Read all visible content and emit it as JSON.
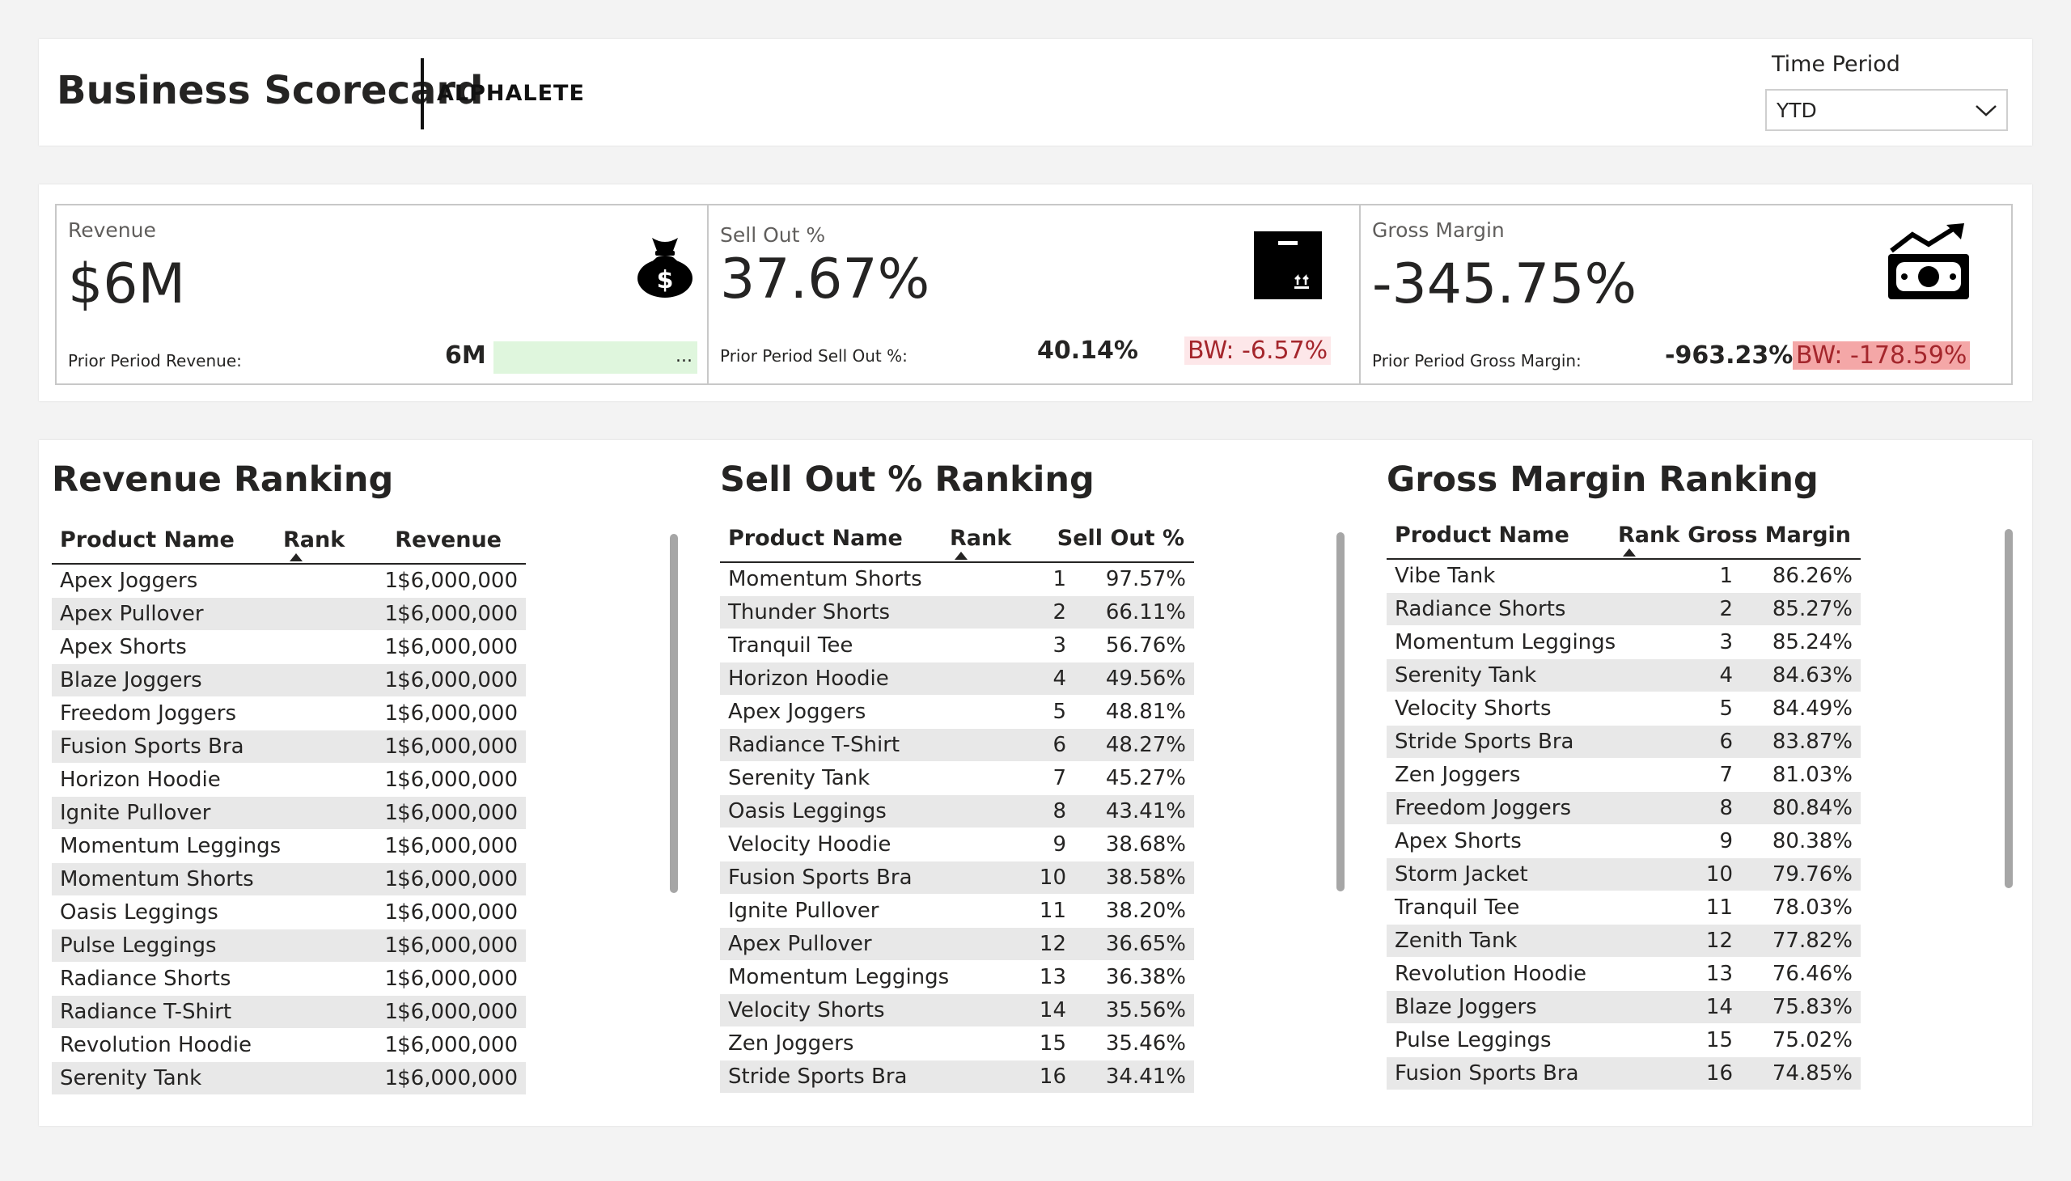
{
  "header": {
    "title": "Business Scorecard",
    "brand": "ALPHALETE",
    "time_period_label": "Time Period",
    "time_period_value": "YTD"
  },
  "kpis": {
    "revenue": {
      "label": "Revenue",
      "value": "$6M",
      "prior_label": "Prior Period Revenue:",
      "prior_value": "6M",
      "more": "...",
      "icon": "money-bag-icon"
    },
    "sellout": {
      "label": "Sell Out %",
      "value": "37.67%",
      "prior_label": "Prior Period Sell Out %:",
      "prior_value": "40.14%",
      "bw": "BW: -6.57%",
      "icon": "box-icon"
    },
    "margin": {
      "label": "Gross Margin",
      "value": "-345.75%",
      "prior_label": "Prior Period Gross Margin:",
      "prior_value": "-963.23%",
      "bw": "BW: -178.59%",
      "icon": "cash-growth-icon"
    }
  },
  "colors": {
    "positive_bg": "#dff6dd",
    "light_negative_bg": "#fde7e9",
    "strong_negative_bg": "#f4a7a7",
    "negative_text": "#a4262c"
  },
  "rankings": {
    "revenue": {
      "title": "Revenue Ranking",
      "columns": [
        "Product Name",
        "Rank",
        "Revenue"
      ],
      "rows": [
        [
          "Apex Joggers",
          "1",
          "$6,000,000"
        ],
        [
          "Apex Pullover",
          "1",
          "$6,000,000"
        ],
        [
          "Apex Shorts",
          "1",
          "$6,000,000"
        ],
        [
          "Blaze Joggers",
          "1",
          "$6,000,000"
        ],
        [
          "Freedom Joggers",
          "1",
          "$6,000,000"
        ],
        [
          "Fusion Sports Bra",
          "1",
          "$6,000,000"
        ],
        [
          "Horizon Hoodie",
          "1",
          "$6,000,000"
        ],
        [
          "Ignite Pullover",
          "1",
          "$6,000,000"
        ],
        [
          "Momentum Leggings",
          "1",
          "$6,000,000"
        ],
        [
          "Momentum Shorts",
          "1",
          "$6,000,000"
        ],
        [
          "Oasis Leggings",
          "1",
          "$6,000,000"
        ],
        [
          "Pulse Leggings",
          "1",
          "$6,000,000"
        ],
        [
          "Radiance Shorts",
          "1",
          "$6,000,000"
        ],
        [
          "Radiance T-Shirt",
          "1",
          "$6,000,000"
        ],
        [
          "Revolution Hoodie",
          "1",
          "$6,000,000"
        ],
        [
          "Serenity Tank",
          "1",
          "$6,000,000"
        ]
      ]
    },
    "sellout": {
      "title": "Sell Out % Ranking",
      "columns": [
        "Product Name",
        "Rank",
        "Sell Out %"
      ],
      "rows": [
        [
          "Momentum Shorts",
          "1",
          "97.57%"
        ],
        [
          "Thunder Shorts",
          "2",
          "66.11%"
        ],
        [
          "Tranquil Tee",
          "3",
          "56.76%"
        ],
        [
          "Horizon Hoodie",
          "4",
          "49.56%"
        ],
        [
          "Apex Joggers",
          "5",
          "48.81%"
        ],
        [
          "Radiance T-Shirt",
          "6",
          "48.27%"
        ],
        [
          "Serenity Tank",
          "7",
          "45.27%"
        ],
        [
          "Oasis Leggings",
          "8",
          "43.41%"
        ],
        [
          "Velocity Hoodie",
          "9",
          "38.68%"
        ],
        [
          "Fusion Sports Bra",
          "10",
          "38.58%"
        ],
        [
          "Ignite Pullover",
          "11",
          "38.20%"
        ],
        [
          "Apex Pullover",
          "12",
          "36.65%"
        ],
        [
          "Momentum Leggings",
          "13",
          "36.38%"
        ],
        [
          "Velocity Shorts",
          "14",
          "35.56%"
        ],
        [
          "Zen Joggers",
          "15",
          "35.46%"
        ],
        [
          "Stride Sports Bra",
          "16",
          "34.41%"
        ]
      ]
    },
    "margin": {
      "title": "Gross Margin Ranking",
      "columns": [
        "Product Name",
        "Rank",
        "Gross Margin"
      ],
      "rows": [
        [
          "Vibe Tank",
          "1",
          "86.26%"
        ],
        [
          "Radiance Shorts",
          "2",
          "85.27%"
        ],
        [
          "Momentum Leggings",
          "3",
          "85.24%"
        ],
        [
          "Serenity Tank",
          "4",
          "84.63%"
        ],
        [
          "Velocity Shorts",
          "5",
          "84.49%"
        ],
        [
          "Stride Sports Bra",
          "6",
          "83.87%"
        ],
        [
          "Zen Joggers",
          "7",
          "81.03%"
        ],
        [
          "Freedom Joggers",
          "8",
          "80.84%"
        ],
        [
          "Apex Shorts",
          "9",
          "80.38%"
        ],
        [
          "Storm Jacket",
          "10",
          "79.76%"
        ],
        [
          "Tranquil Tee",
          "11",
          "78.03%"
        ],
        [
          "Zenith Tank",
          "12",
          "77.82%"
        ],
        [
          "Revolution Hoodie",
          "13",
          "76.46%"
        ],
        [
          "Blaze Joggers",
          "14",
          "75.83%"
        ],
        [
          "Pulse Leggings",
          "15",
          "75.02%"
        ],
        [
          "Fusion Sports Bra",
          "16",
          "74.85%"
        ]
      ]
    }
  }
}
